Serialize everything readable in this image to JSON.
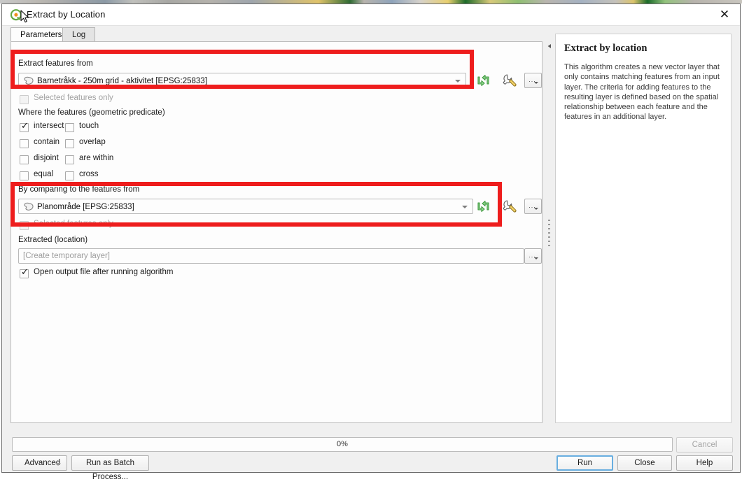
{
  "window": {
    "title": "Extract by Location",
    "logo_icon": "qgis-logo-icon",
    "close_icon": "close-icon"
  },
  "tabs": [
    {
      "label": "Parameters",
      "active": true
    },
    {
      "label": "Log",
      "active": false
    }
  ],
  "parameters": {
    "input_label": "Extract features from",
    "input_value": "Barnetråkk - 250m grid - aktivitet [EPSG:25833]",
    "input_layer_icon": "polygon-layer-icon",
    "input_selected_only_label": "Selected features only",
    "predicate_label": "Where the features (geometric predicate)",
    "predicates": [
      {
        "label": "intersect",
        "checked": true
      },
      {
        "label": "touch",
        "checked": false
      },
      {
        "label": "contain",
        "checked": false
      },
      {
        "label": "overlap",
        "checked": false
      },
      {
        "label": "disjoint",
        "checked": false
      },
      {
        "label": "are within",
        "checked": false
      },
      {
        "label": "equal",
        "checked": false
      },
      {
        "label": "cross",
        "checked": false
      }
    ],
    "compare_label": "By comparing to the features from",
    "compare_value": "Planområde [EPSG:25833]",
    "compare_layer_icon": "polygon-layer-icon",
    "compare_selected_only_label": "Selected features only",
    "output_label": "Extracted (location)",
    "output_placeholder": "[Create temporary layer]",
    "output_browse_label": "…",
    "open_output_label": "Open output file after running algorithm",
    "open_output_checked": true,
    "iterate_icon": "iterate-features-icon",
    "advanced_options_icon": "wrench-icon",
    "browse_icon": "dots-dropdown-icon"
  },
  "help": {
    "title": "Extract by location",
    "body": "This algorithm creates a new vector layer that only contains matching features from an input layer. The criteria for adding features to the resulting layer is defined based on the spatial relationship between each feature and the features in an additional layer."
  },
  "splitter": {
    "collapse_icon": "collapse-left-icon",
    "grip_icon": "splitter-grip-icon"
  },
  "progress": {
    "percent_label": "0%",
    "value": 0
  },
  "buttons": {
    "advanced": "Advanced",
    "run_as_batch": "Run as Batch Process...",
    "cancel": "Cancel",
    "run": "Run",
    "close": "Close",
    "help": "Help"
  },
  "colors": {
    "annotation_red": "#ee1d1d",
    "default_button_focus": "#68aee0",
    "qgis_green": "#63a844",
    "qgis_orange": "#f0901c"
  }
}
